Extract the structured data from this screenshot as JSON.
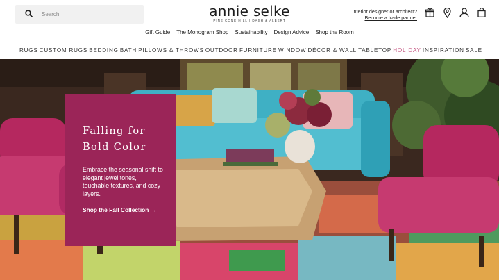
{
  "header": {
    "search_placeholder": "Search",
    "logo": {
      "name": "annie selke",
      "tagline": "PINE CONE HILL | DASH & ALBERT"
    },
    "trade": {
      "question": "Interior designer or architect?",
      "link": "Become a trade partner"
    },
    "icons": [
      "gift-icon",
      "location-pin-icon",
      "account-icon",
      "shopping-bag-icon"
    ]
  },
  "subnav": [
    "Gift Guide",
    "The Monogram Shop",
    "Sustainability",
    "Design Advice",
    "Shop the Room"
  ],
  "mainnav": [
    {
      "label": "RUGS",
      "color": "#333333"
    },
    {
      "label": "CUSTOM RUGS",
      "color": "#333333"
    },
    {
      "label": "BEDDING",
      "color": "#333333"
    },
    {
      "label": "BATH",
      "color": "#333333"
    },
    {
      "label": "PILLOWS & THROWS",
      "color": "#333333"
    },
    {
      "label": "OUTDOOR",
      "color": "#333333"
    },
    {
      "label": "FURNITURE",
      "color": "#333333"
    },
    {
      "label": "WINDOW",
      "color": "#333333"
    },
    {
      "label": "DÉCOR & WALL",
      "color": "#333333"
    },
    {
      "label": "TABLETOP",
      "color": "#333333"
    },
    {
      "label": "HOLIDAY",
      "color": "#c4537f"
    },
    {
      "label": "INSPIRATION",
      "color": "#333333"
    },
    {
      "label": "SALE",
      "color": "#333333"
    }
  ],
  "hero": {
    "headline": "Falling for\nBold Color",
    "body": "Embrace the seasonal shift to elegant jewel tones, touchable textures, and cozy layers.",
    "cta": "Shop the Fall Collection",
    "cta_arrow": "→",
    "card_color": "#9b2558"
  }
}
